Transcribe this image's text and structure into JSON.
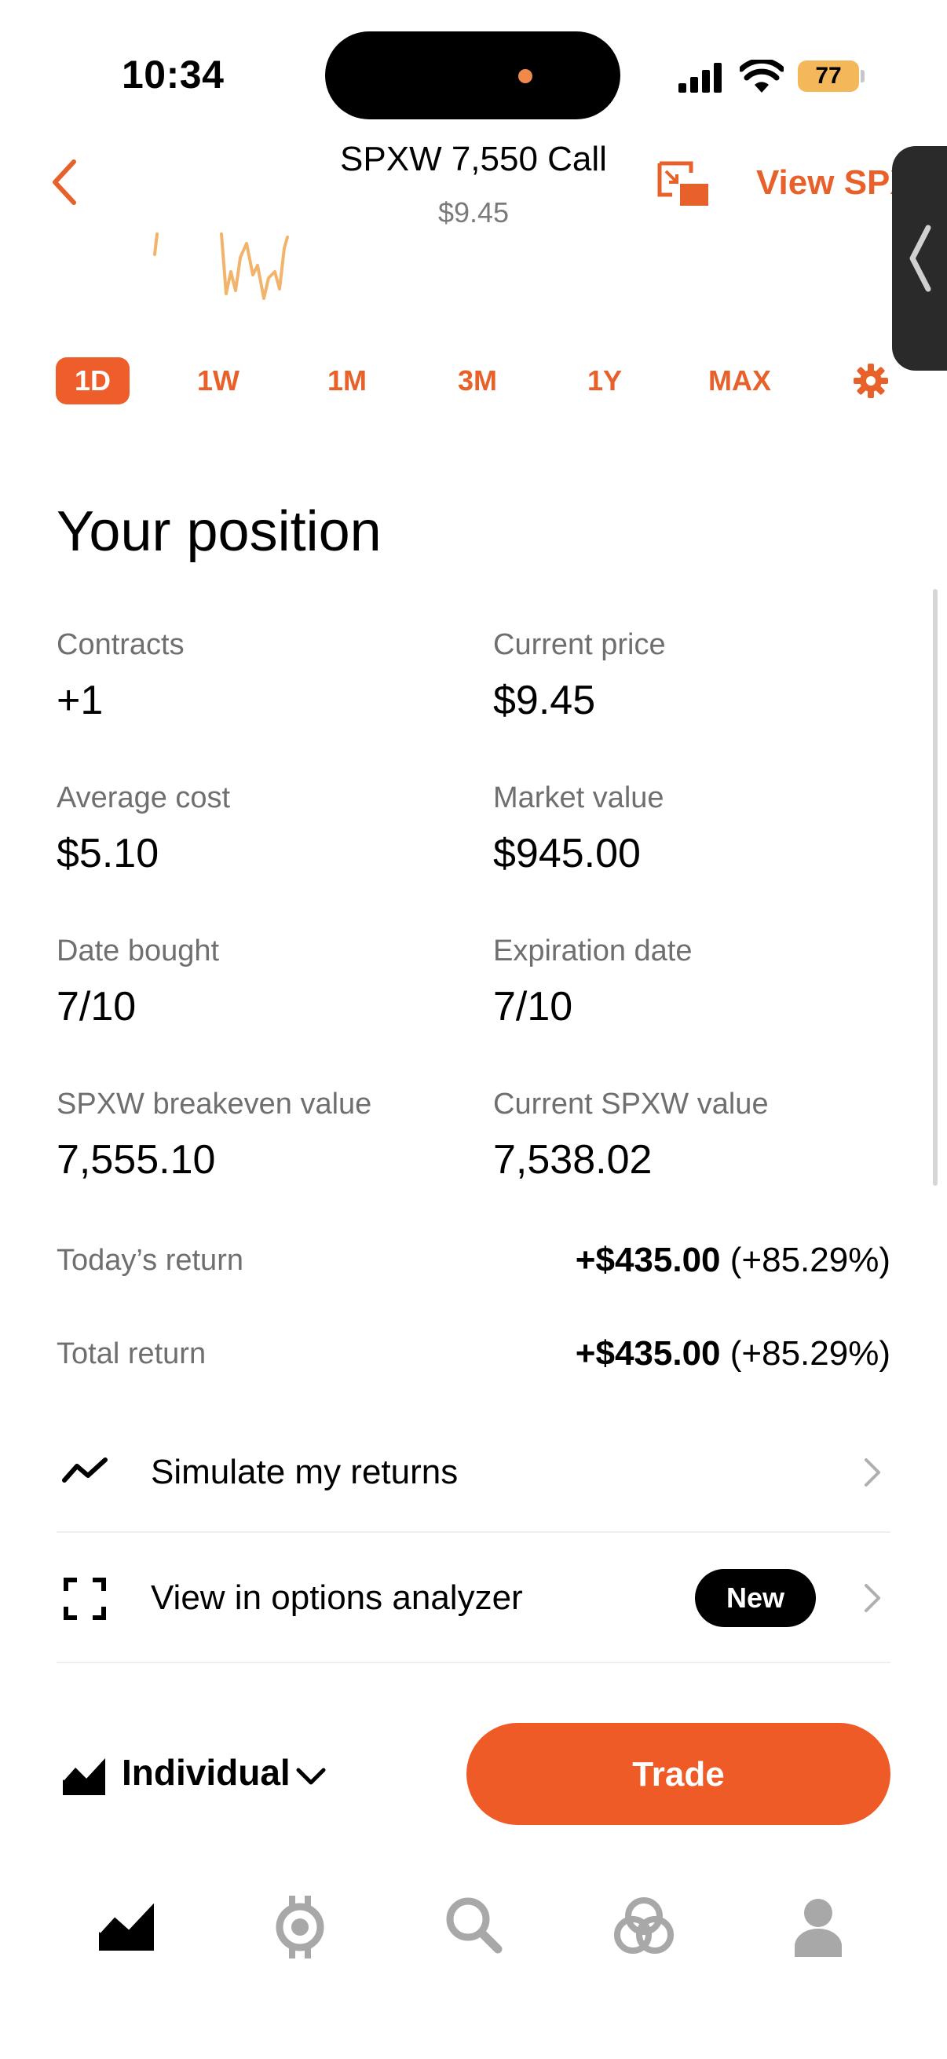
{
  "status": {
    "time": "10:34",
    "battery": "77"
  },
  "header": {
    "title": "SPXW 7,550 Call",
    "price": "$9.45",
    "view_link": "View SPX"
  },
  "ranges": [
    "1D",
    "1W",
    "1M",
    "3M",
    "1Y",
    "MAX"
  ],
  "active_range": "1D",
  "position": {
    "title": "Your position",
    "fields": [
      {
        "label": "Contracts",
        "value": "+1"
      },
      {
        "label": "Current price",
        "value": "$9.45"
      },
      {
        "label": "Average cost",
        "value": "$5.10"
      },
      {
        "label": "Market value",
        "value": "$945.00"
      },
      {
        "label": "Date bought",
        "value": "7/10"
      },
      {
        "label": "Expiration date",
        "value": "7/10"
      },
      {
        "label": "SPXW breakeven value",
        "value": "7,555.10"
      },
      {
        "label": "Current SPXW value",
        "value": "7,538.02"
      }
    ],
    "todays_return": {
      "label": "Today’s return",
      "amount": "+$435.00",
      "percent": "(+85.29%)"
    },
    "total_return": {
      "label": "Total return",
      "amount": "+$435.00",
      "percent": "(+85.29%)"
    }
  },
  "actions": {
    "simulate": "Simulate my returns",
    "analyzer": "View in options analyzer",
    "new_badge": "New"
  },
  "footer": {
    "account": "Individual",
    "trade": "Trade"
  },
  "colors": {
    "accent": "#e8612a",
    "button": "#ee5b27"
  }
}
